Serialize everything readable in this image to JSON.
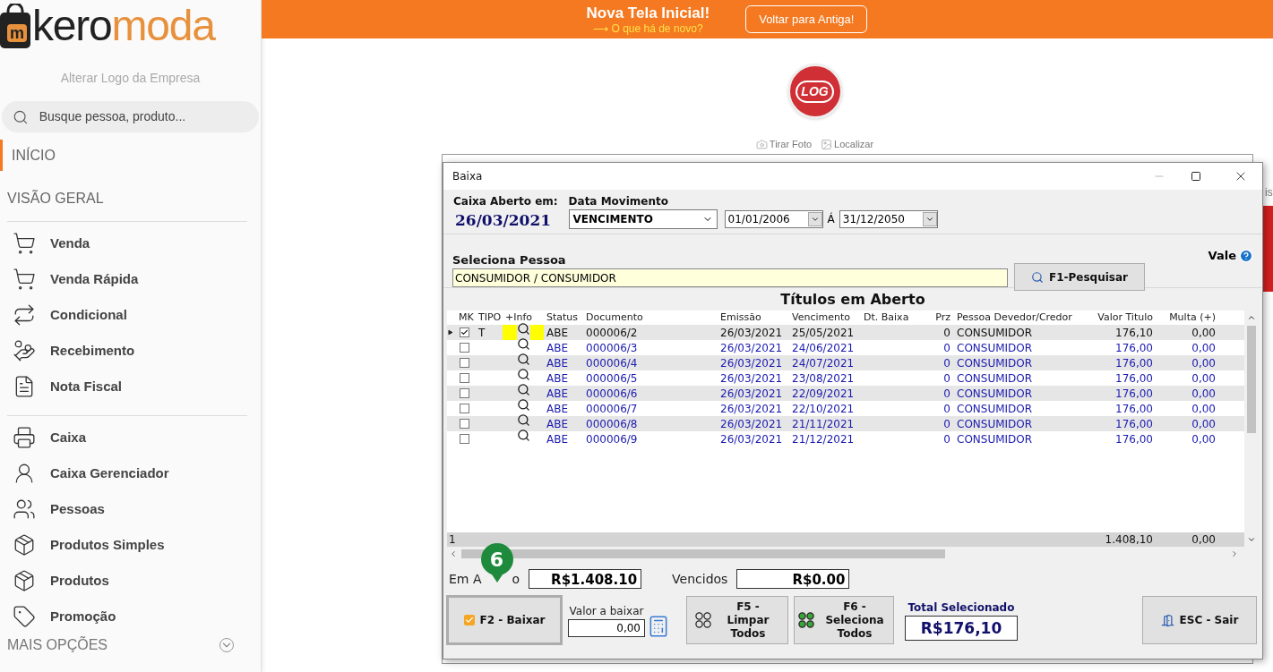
{
  "sidebar": {
    "logo": {
      "bag_letter": "m",
      "text_dark": "kero",
      "text_accent": "moda"
    },
    "change_logo": "Alterar Logo da Empresa",
    "search": {
      "placeholder": "Busque pessoa, produto..."
    },
    "nav_top": [
      {
        "label": "INÍCIO",
        "selected": true
      },
      {
        "label": "VISÃO GERAL",
        "selected": false
      }
    ],
    "groups": [
      [
        {
          "label": "Venda"
        },
        {
          "label": "Venda Rápida"
        },
        {
          "label": "Condicional"
        },
        {
          "label": "Recebimento"
        },
        {
          "label": "Nota Fiscal"
        }
      ],
      [
        {
          "label": "Caixa"
        },
        {
          "label": "Caixa Gerenciador"
        },
        {
          "label": "Pessoas"
        },
        {
          "label": "Produtos Simples"
        },
        {
          "label": "Produtos"
        },
        {
          "label": "Promoção"
        }
      ]
    ],
    "more": "MAIS OPÇÕES"
  },
  "banner": {
    "title": "Nova Tela Inicial!",
    "subtitle": "⟶ O que há de novo?",
    "button": "Voltar para Antiga!"
  },
  "company": {
    "logo_text": "LOG",
    "actions": [
      "Tirar Foto",
      "Localizar"
    ]
  },
  "edge_text": "is",
  "dialog": {
    "title": "Baixa",
    "caixa": {
      "label": "Caixa Aberto em:",
      "value": "26/03/2021"
    },
    "movimento": {
      "label": "Data Movimento",
      "value": "VENCIMENTO"
    },
    "date_from": "01/01/2006",
    "date_sep": "Á",
    "date_to": "31/12/2050",
    "pessoa": {
      "label": "Seleciona Pessoa",
      "value": "CONSUMIDOR / CONSUMIDOR"
    },
    "search_button": "F1-Pesquisar",
    "vale": "Vale",
    "table": {
      "title": "Títulos em Aberto",
      "columns": [
        "MK",
        "TIPO",
        "+Info",
        "Status",
        "Documento",
        "Emissão",
        "Vencimento",
        "Dt. Baixa",
        "Prz",
        "Pessoa Devedor/Credor",
        "Valor Titulo",
        "Multa (+)"
      ],
      "rows": [
        {
          "selected": true,
          "checked": true,
          "tipo": "T",
          "status": "ABE",
          "documento": "000006/2",
          "emissao": "26/03/2021",
          "vencimento": "25/05/2021",
          "prz": "0",
          "pessoa": "CONSUMIDOR",
          "valor": "176,10",
          "multa": "0,00"
        },
        {
          "selected": false,
          "checked": false,
          "status": "ABE",
          "documento": "000006/3",
          "emissao": "26/03/2021",
          "vencimento": "24/06/2021",
          "prz": "0",
          "pessoa": "CONSUMIDOR",
          "valor": "176,00",
          "multa": "0,00"
        },
        {
          "selected": false,
          "checked": false,
          "status": "ABE",
          "documento": "000006/4",
          "emissao": "26/03/2021",
          "vencimento": "24/07/2021",
          "prz": "0",
          "pessoa": "CONSUMIDOR",
          "valor": "176,00",
          "multa": "0,00"
        },
        {
          "selected": false,
          "checked": false,
          "status": "ABE",
          "documento": "000006/5",
          "emissao": "26/03/2021",
          "vencimento": "23/08/2021",
          "prz": "0",
          "pessoa": "CONSUMIDOR",
          "valor": "176,00",
          "multa": "0,00"
        },
        {
          "selected": false,
          "checked": false,
          "status": "ABE",
          "documento": "000006/6",
          "emissao": "26/03/2021",
          "vencimento": "22/09/2021",
          "prz": "0",
          "pessoa": "CONSUMIDOR",
          "valor": "176,00",
          "multa": "0,00"
        },
        {
          "selected": false,
          "checked": false,
          "status": "ABE",
          "documento": "000006/7",
          "emissao": "26/03/2021",
          "vencimento": "22/10/2021",
          "prz": "0",
          "pessoa": "CONSUMIDOR",
          "valor": "176,00",
          "multa": "0,00"
        },
        {
          "selected": false,
          "checked": false,
          "status": "ABE",
          "documento": "000006/8",
          "emissao": "26/03/2021",
          "vencimento": "21/11/2021",
          "prz": "0",
          "pessoa": "CONSUMIDOR",
          "valor": "176,00",
          "multa": "0,00"
        },
        {
          "selected": false,
          "checked": false,
          "status": "ABE",
          "documento": "000006/9",
          "emissao": "26/03/2021",
          "vencimento": "21/12/2021",
          "prz": "0",
          "pessoa": "CONSUMIDOR",
          "valor": "176,00",
          "multa": "0,00"
        }
      ],
      "footer": {
        "count": "1",
        "valor": "1.408,10",
        "multa": "0,00"
      }
    },
    "em_aberto": {
      "label_parts": [
        "Em A",
        "o"
      ],
      "value": "R$1.408.10"
    },
    "vencidos": {
      "label": "Vencidos",
      "value": "R$0.00"
    },
    "step_marker": "6",
    "baixar_button": "F2 - Baixar",
    "valor_baixar": {
      "label": "Valor a baixar",
      "value": "0,00"
    },
    "limpar_button": "F5 -Limpar Todos",
    "seleciona_button": "F6 - Seleciona Todos",
    "total": {
      "label": "Total Selecionado",
      "value": "R$176,10"
    },
    "sair_button": "ESC - Sair"
  }
}
